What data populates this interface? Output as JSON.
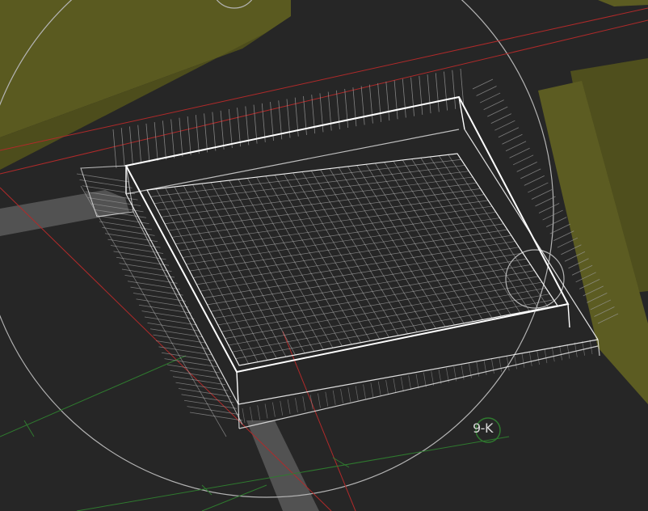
{
  "viewport": {
    "background": "#262626",
    "grid_label": "9-K",
    "colors": {
      "wireframe": "#ffffff",
      "wireframe_dim": "#c8c8c8",
      "hatch": "#9a9a9a",
      "olive_mass": "#5c5c22",
      "olive_mass_light": "#6b6b28",
      "grey_beam": "#6a6a6a",
      "red_reference_line": "#b02a2a",
      "green_grid_line": "#2f7a2f",
      "section_circle": "#b4b4b4"
    },
    "icons": [
      "grid-bubble-icon",
      "section-circle-icon"
    ]
  }
}
